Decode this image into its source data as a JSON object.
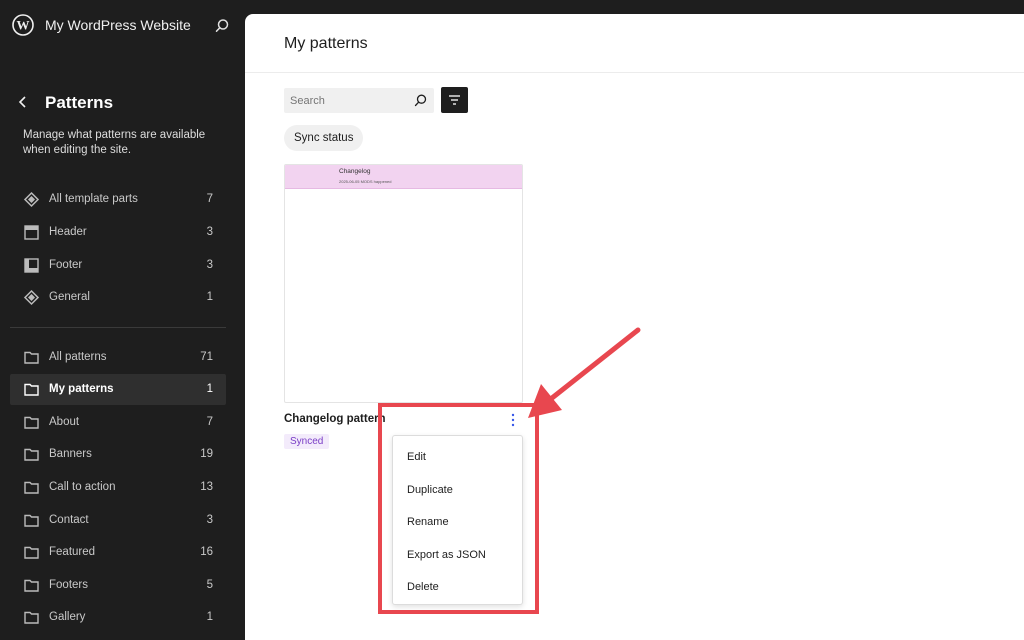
{
  "site": {
    "title": "My WordPress Website"
  },
  "sidebar": {
    "section_title": "Patterns",
    "description": "Manage what patterns are available when editing the site.",
    "template_parts": [
      {
        "label": "All template parts",
        "count": "7",
        "icon": "diamond-icon"
      },
      {
        "label": "Header",
        "count": "3",
        "icon": "header-layout-icon"
      },
      {
        "label": "Footer",
        "count": "3",
        "icon": "footer-layout-icon"
      },
      {
        "label": "General",
        "count": "1",
        "icon": "diamond-icon"
      }
    ],
    "categories": [
      {
        "label": "All patterns",
        "count": "71",
        "icon": "folder-icon"
      },
      {
        "label": "My patterns",
        "count": "1",
        "icon": "folder-icon",
        "active": true
      },
      {
        "label": "About",
        "count": "7",
        "icon": "folder-icon"
      },
      {
        "label": "Banners",
        "count": "19",
        "icon": "folder-icon"
      },
      {
        "label": "Call to action",
        "count": "13",
        "icon": "folder-icon"
      },
      {
        "label": "Contact",
        "count": "3",
        "icon": "folder-icon"
      },
      {
        "label": "Featured",
        "count": "16",
        "icon": "folder-icon"
      },
      {
        "label": "Footers",
        "count": "5",
        "icon": "folder-icon"
      },
      {
        "label": "Gallery",
        "count": "1",
        "icon": "folder-icon"
      }
    ]
  },
  "main": {
    "title": "My patterns",
    "search": {
      "placeholder": "Search",
      "value": ""
    },
    "filter_chip": "Sync status",
    "pattern": {
      "title": "Changelog pattern",
      "badge": "Synced",
      "preview_title": "Changelog",
      "preview_text": "2025-06-05 MODS happened"
    },
    "menu": {
      "items": [
        "Edit",
        "Duplicate",
        "Rename",
        "Export as JSON",
        "Delete"
      ]
    }
  },
  "colors": {
    "sidebar_bg": "#1e1e1e",
    "badge_text": "#7a3ec6",
    "preview_band": "#f2d3f0",
    "annotation": "#e8474f"
  }
}
